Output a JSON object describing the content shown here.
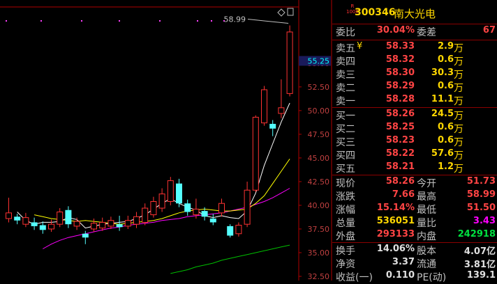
{
  "chart": {
    "y_ticks": [
      "55.00",
      "52.50",
      "50.00",
      "47.50",
      "45.00",
      "42.50",
      "40.00",
      "37.50",
      "35.00",
      "32.50"
    ],
    "current_price_label": "55.25",
    "high_annotation": "58.99",
    "colors": {
      "up": "#ff3232",
      "down": "#54ffff",
      "ma5": "#ffffff",
      "ma10": "#ffff00",
      "ma20": "#ff00ff",
      "ma60": "#00c000",
      "axis": "#b00000"
    }
  },
  "chart_data": {
    "type": "candlestick",
    "ylim": [
      32.5,
      60.5
    ],
    "candles": [
      {
        "o": 38.6,
        "c": 39.2,
        "h": 40.8,
        "l": 38.2
      },
      {
        "o": 38.8,
        "c": 38.4,
        "h": 39.1,
        "l": 38.0
      },
      {
        "o": 38.0,
        "c": 38.7,
        "h": 39.2,
        "l": 37.7
      },
      {
        "o": 38.2,
        "c": 37.8,
        "h": 38.7,
        "l": 37.4
      },
      {
        "o": 37.9,
        "c": 37.4,
        "h": 38.3,
        "l": 37.0
      },
      {
        "o": 37.5,
        "c": 38.0,
        "h": 38.5,
        "l": 37.2
      },
      {
        "o": 38.0,
        "c": 39.3,
        "h": 39.7,
        "l": 37.7
      },
      {
        "o": 39.5,
        "c": 38.0,
        "h": 39.9,
        "l": 37.6
      },
      {
        "o": 37.8,
        "c": 38.3,
        "h": 38.7,
        "l": 37.4
      },
      {
        "o": 37.0,
        "c": 36.6,
        "h": 37.3,
        "l": 35.9
      },
      {
        "o": 37.5,
        "c": 38.1,
        "h": 38.6,
        "l": 37.2
      },
      {
        "o": 37.6,
        "c": 38.2,
        "h": 38.7,
        "l": 37.3
      },
      {
        "o": 37.8,
        "c": 38.4,
        "h": 38.8,
        "l": 37.5
      },
      {
        "o": 38.0,
        "c": 37.7,
        "h": 38.9,
        "l": 37.3
      },
      {
        "o": 37.8,
        "c": 38.4,
        "h": 38.9,
        "l": 37.5
      },
      {
        "o": 38.0,
        "c": 38.8,
        "h": 39.3,
        "l": 37.6
      },
      {
        "o": 38.2,
        "c": 39.7,
        "h": 40.2,
        "l": 37.9
      },
      {
        "o": 39.0,
        "c": 40.4,
        "h": 40.9,
        "l": 38.7
      },
      {
        "o": 39.7,
        "c": 41.2,
        "h": 41.8,
        "l": 39.3
      },
      {
        "o": 40.4,
        "c": 42.6,
        "h": 43.0,
        "l": 40.0
      },
      {
        "o": 42.3,
        "c": 40.2,
        "h": 42.8,
        "l": 39.8
      },
      {
        "o": 40.2,
        "c": 39.3,
        "h": 40.6,
        "l": 38.9
      },
      {
        "o": 39.0,
        "c": 39.6,
        "h": 40.7,
        "l": 38.6
      },
      {
        "o": 39.4,
        "c": 38.8,
        "h": 39.8,
        "l": 38.4
      },
      {
        "o": 38.6,
        "c": 38.2,
        "h": 39.1,
        "l": 37.9
      },
      {
        "o": 39.2,
        "c": 40.2,
        "h": 40.7,
        "l": 38.8
      },
      {
        "o": 37.8,
        "c": 36.8,
        "h": 38.0,
        "l": 36.6
      },
      {
        "o": 37.0,
        "c": 37.9,
        "h": 38.2,
        "l": 36.7
      },
      {
        "o": 38.0,
        "c": 41.6,
        "h": 42.5,
        "l": 37.7
      },
      {
        "o": 41.6,
        "c": 49.3,
        "h": 49.5,
        "l": 41.4
      },
      {
        "o": 48.7,
        "c": 52.2,
        "h": 52.6,
        "l": 48.4
      },
      {
        "o": 48.6,
        "c": 48.1,
        "h": 49.0,
        "l": 47.3
      },
      {
        "o": 49.7,
        "c": 50.3,
        "h": 53.3,
        "l": 49.2
      },
      {
        "o": 51.8,
        "c": 58.3,
        "h": 58.99,
        "l": 51.5
      }
    ],
    "ma5": [
      39.3,
      38.4,
      38.0,
      38.2,
      38.2,
      38.3,
      38.7,
      38.5,
      37.6,
      37.8,
      38.0,
      38.1,
      38.2,
      38.3,
      38.6,
      39.0,
      39.6,
      40.2,
      40.7,
      40.2,
      39.8,
      39.5,
      38.9,
      38.7,
      38.9,
      38.7,
      38.6,
      39.4,
      41.3,
      44.2,
      46.5,
      48.8,
      50.8
    ],
    "ma10": [
      39.0,
      38.8,
      38.6,
      38.5,
      38.4,
      38.3,
      38.4,
      38.3,
      38.2,
      38.1,
      38.0,
      38.1,
      38.2,
      38.3,
      38.4,
      38.6,
      38.9,
      39.2,
      39.4,
      39.5,
      39.6,
      39.5,
      39.4,
      39.4,
      39.5,
      39.6,
      40.2,
      41.0,
      42.3,
      43.6,
      44.9
    ],
    "ma20": [
      35.4,
      35.9,
      36.3,
      36.6,
      36.8,
      37.0,
      37.2,
      37.4,
      37.6,
      37.7,
      37.9,
      38.0,
      38.1,
      38.2,
      38.4,
      38.5,
      38.6,
      38.8,
      38.9,
      39.0,
      39.1,
      39.2,
      39.4,
      39.6,
      39.8,
      40.1,
      40.4,
      40.8,
      41.3,
      41.8
    ],
    "ma60": [
      32.8,
      33.0,
      33.2,
      33.5,
      33.7,
      33.9,
      34.2,
      34.4,
      34.6,
      34.8,
      35.0,
      35.2,
      35.4,
      35.6,
      35.8
    ]
  },
  "header": {
    "logo_r": "R",
    "logo_num": "1000",
    "code": "300346",
    "name": "南大光电"
  },
  "weibi": {
    "label": "委比",
    "value": "30.04%",
    "label2": "委差",
    "value2": "67"
  },
  "asks": [
    {
      "label": "卖五",
      "mark": "¥",
      "price": "58.33",
      "vol": "2.9",
      "unit": "万"
    },
    {
      "label": "卖四",
      "mark": "",
      "price": "58.32",
      "vol": "0.6",
      "unit": "万"
    },
    {
      "label": "卖三",
      "mark": "",
      "price": "58.30",
      "vol": "30.3",
      "unit": "万"
    },
    {
      "label": "卖二",
      "mark": "",
      "price": "58.29",
      "vol": "0.6",
      "unit": "万"
    },
    {
      "label": "卖一",
      "mark": "",
      "price": "58.28",
      "vol": "11.1",
      "unit": "万"
    }
  ],
  "bids": [
    {
      "label": "买一",
      "price": "58.26",
      "vol": "24.5",
      "unit": "万"
    },
    {
      "label": "买二",
      "price": "58.25",
      "vol": "0.6",
      "unit": "万"
    },
    {
      "label": "买三",
      "price": "58.23",
      "vol": "0.6",
      "unit": "万"
    },
    {
      "label": "买四",
      "price": "58.22",
      "vol": "57.6",
      "unit": "万"
    },
    {
      "label": "买五",
      "price": "58.21",
      "vol": "1.2",
      "unit": "万"
    }
  ],
  "stats": [
    {
      "l1": "现价",
      "v1": "58.26",
      "c1": "red",
      "l2": "今开",
      "v2": "51.73",
      "c2": "red"
    },
    {
      "l1": "涨跌",
      "v1": "7.66",
      "c1": "red",
      "l2": "最高",
      "v2": "58.99",
      "c2": "red"
    },
    {
      "l1": "涨幅",
      "v1": "15.14%",
      "c1": "red",
      "l2": "最低",
      "v2": "51.50",
      "c2": "red"
    },
    {
      "l1": "总量",
      "v1": "536051",
      "c1": "yel",
      "l2": "量比",
      "v2": "3.43",
      "c2": "mag"
    },
    {
      "l1": "外盘",
      "v1": "293133",
      "c1": "red",
      "l2": "内盘",
      "v2": "242918",
      "c2": "grn"
    }
  ],
  "stats2": [
    {
      "l1": "换手",
      "v1": "14.06%",
      "c1": "wht",
      "l2": "股本",
      "v2": "4.07亿",
      "c2": "wht"
    },
    {
      "l1": "净资",
      "v1": "3.37",
      "c1": "wht",
      "l2": "流通",
      "v2": "3.81亿",
      "c2": "wht"
    },
    {
      "l1": "收益(一)",
      "v1": "0.110",
      "c1": "wht",
      "l2": "PE(动)",
      "v2": "139.1",
      "c2": "wht"
    }
  ]
}
